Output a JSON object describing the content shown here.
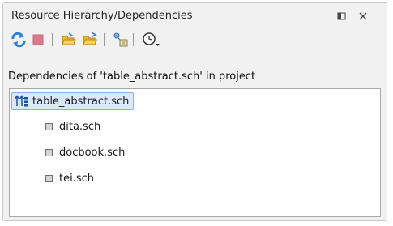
{
  "panel": {
    "title": "Resource Hierarchy/Dependencies"
  },
  "window_buttons": {
    "maximize_icon": "maximize-icon",
    "close_icon": "close-icon"
  },
  "toolbar": {
    "buttons": [
      {
        "icon": "refresh-icon"
      },
      {
        "icon": "stop-icon"
      },
      {
        "icon": "open-folder-icon"
      },
      {
        "icon": "configure-folder-icon"
      },
      {
        "icon": "reference-graph-icon"
      },
      {
        "icon": "history-icon"
      }
    ]
  },
  "dependencies_label": "Dependencies of 'table_abstract.sch' in project",
  "tree": {
    "root": {
      "label": "table_abstract.sch",
      "icon": "dependency-tree-icon",
      "selected": true
    },
    "children": [
      {
        "label": "dita.sch"
      },
      {
        "label": "docbook.sch"
      },
      {
        "label": "tei.sch"
      }
    ]
  },
  "colors": {
    "selection_bg": "#dbe8fb",
    "selection_border": "#8aaee0",
    "refresh_blue": "#2f7fd6",
    "stop_red": "#d9798a",
    "folder_yellow": "#f2b531"
  }
}
